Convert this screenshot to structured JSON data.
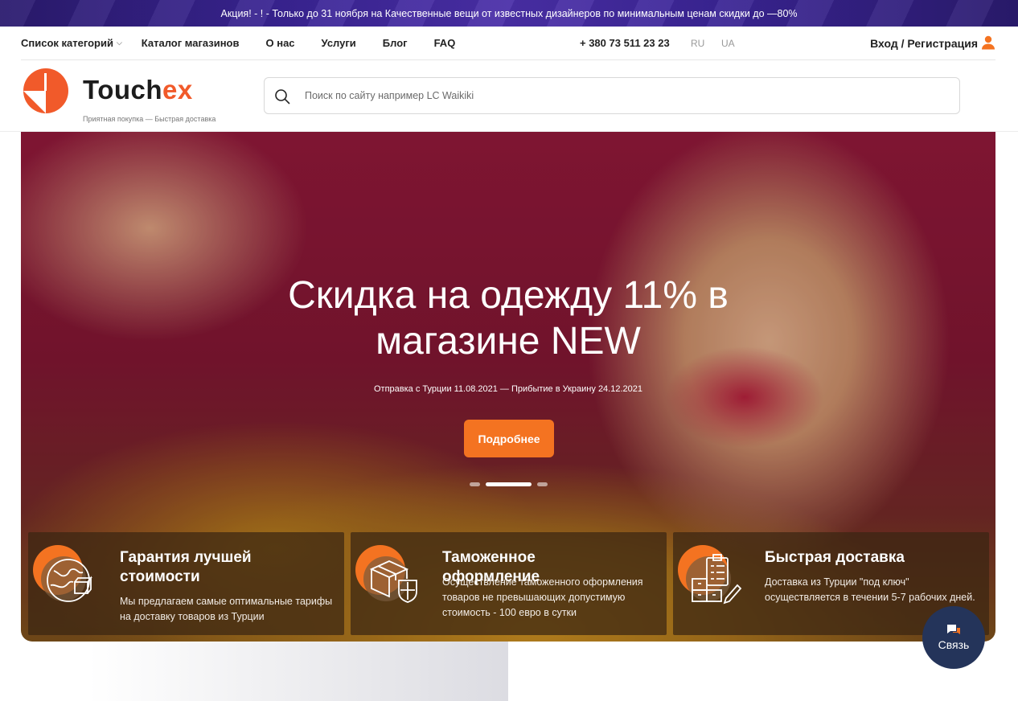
{
  "promo": {
    "text": "Акция! - ! - Только до 31 ноября на Качественные вещи от известных дизайнеров по минимальным ценам скидки до —80%"
  },
  "nav": {
    "categories": "Список категорий",
    "items": [
      "Каталог магазинов",
      "О нас",
      "Услуги",
      "Блог",
      "FAQ"
    ],
    "phone": "+ 380 73 511 23 23",
    "languages": [
      "RU",
      "UA"
    ],
    "login": "Вход / Регистрация"
  },
  "logo": {
    "name_main": "Touch",
    "name_accent": "ex",
    "tagline": "Приятная покупка — Быстрая доставка"
  },
  "search": {
    "placeholder": "Поиск по сайту например LC Waikiki"
  },
  "hero": {
    "title": "Скидка на одежду 11% в магазине NEW",
    "subtitle": "Отправка с Турции 11.08.2021 — Прибытие в Украину 24.12.2021",
    "button": "Подробнее",
    "slides_total": 3,
    "active_slide": 2
  },
  "features": [
    {
      "icon": "globe-box-icon",
      "title": "Гарантия лучшей стоимости",
      "text": "Мы предлагаем самые оптимальные тарифы на доставку товаров из Турции"
    },
    {
      "icon": "customs-box-icon",
      "title": "Таможенное оформление",
      "text": "Осуществление таможенного оформления товаров не превышающих допустимую стоимость - 100 евро в сутки"
    },
    {
      "icon": "delivery-checklist-icon",
      "title": "Быстрая доставка",
      "text": "Доставка из Турции \"под ключ\" осуществляется в течении 5-7 рабочих дней."
    }
  ],
  "chat": {
    "label": "Связь"
  },
  "colors": {
    "accent": "#f47321",
    "promo_bar": "#3b2596",
    "chat_bubble": "#24345a"
  }
}
